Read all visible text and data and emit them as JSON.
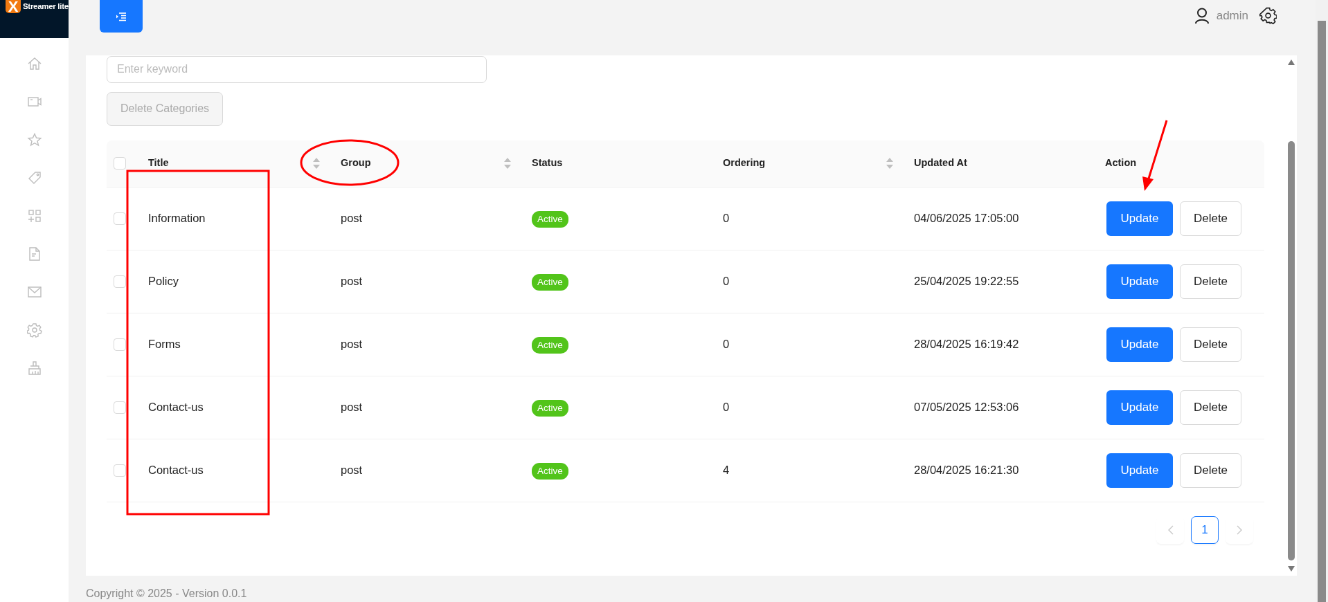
{
  "brand": {
    "logo_letter": "X",
    "name": "Streamer lite"
  },
  "user": {
    "name": "admin"
  },
  "search": {
    "placeholder": "Enter keyword"
  },
  "delete_categories_button": {
    "label": "Delete Categories",
    "disabled": true
  },
  "table": {
    "select_all_checked": false,
    "columns": [
      {
        "label": "Title",
        "sortable": true
      },
      {
        "label": "Group",
        "sortable": true
      },
      {
        "label": "Status",
        "sortable": false
      },
      {
        "label": "Ordering",
        "sortable": true
      },
      {
        "label": "Updated At",
        "sortable": false
      },
      {
        "label": "Action",
        "sortable": false
      }
    ],
    "rows": [
      {
        "checked": false,
        "title": "Information",
        "group": "post",
        "status": "Active",
        "ordering": "0",
        "updated_at": "04/06/2025 17:05:00",
        "actions": [
          "Update",
          "Delete"
        ]
      },
      {
        "checked": false,
        "title": "Policy",
        "group": "post",
        "status": "Active",
        "ordering": "0",
        "updated_at": "25/04/2025 19:22:55",
        "actions": [
          "Update",
          "Delete"
        ]
      },
      {
        "checked": false,
        "title": "Forms",
        "group": "post",
        "status": "Active",
        "ordering": "0",
        "updated_at": "28/04/2025 16:19:42",
        "actions": [
          "Update",
          "Delete"
        ]
      },
      {
        "checked": false,
        "title": "Contact-us",
        "group": "post",
        "status": "Active",
        "ordering": "0",
        "updated_at": "07/05/2025 12:53:06",
        "actions": [
          "Update",
          "Delete"
        ]
      },
      {
        "checked": false,
        "title": "Contact-us",
        "group": "post",
        "status": "Active",
        "ordering": "4",
        "updated_at": "28/04/2025 16:21:30",
        "actions": [
          "Update",
          "Delete"
        ]
      }
    ]
  },
  "pagination": {
    "prev_disabled": true,
    "next_disabled": true,
    "pages": [
      {
        "label": "1",
        "selected": true
      }
    ]
  },
  "footer": "Copyright © 2025 - Version 0.0.1",
  "annotations": [
    {
      "kind": "rectangle"
    },
    {
      "kind": "ellipse"
    },
    {
      "kind": "arrow"
    }
  ]
}
